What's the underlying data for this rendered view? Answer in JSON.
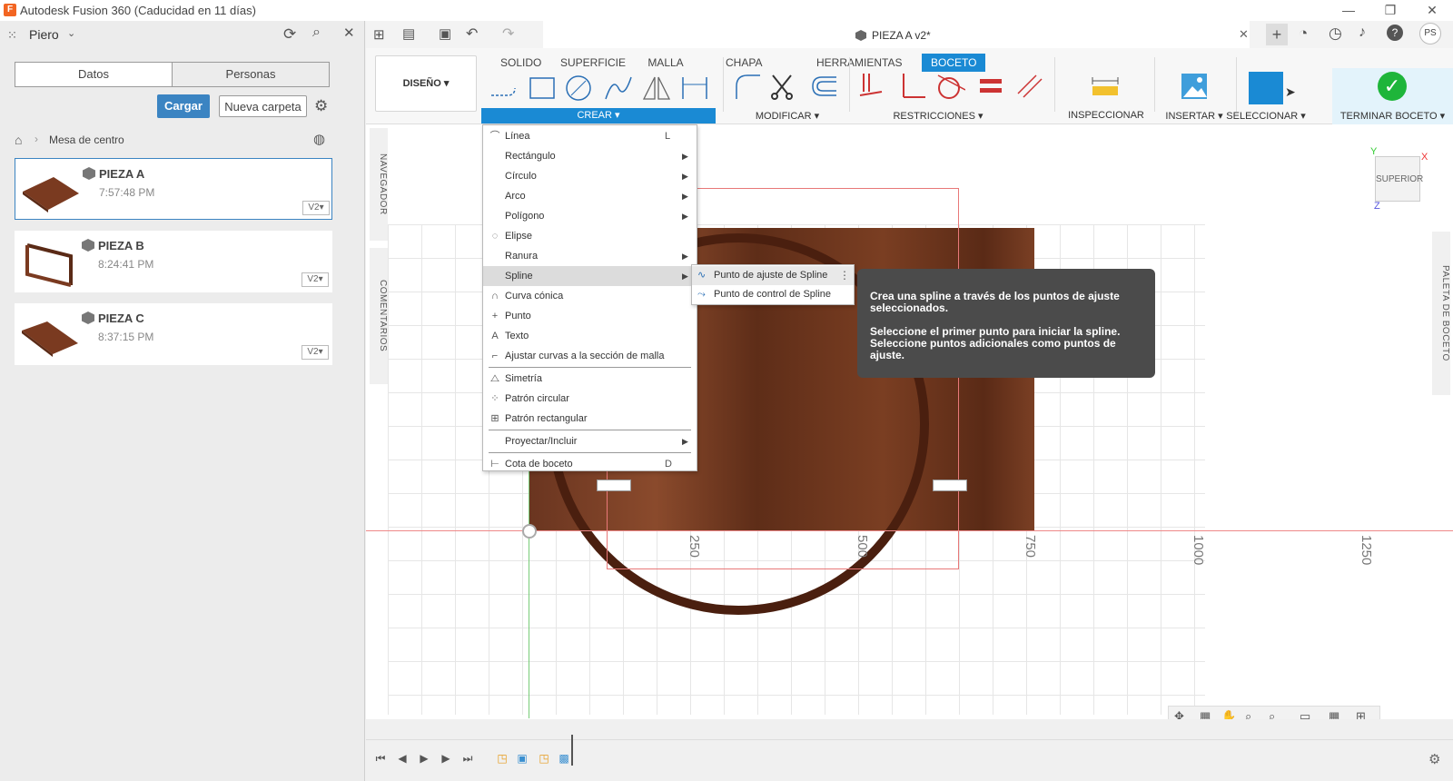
{
  "window": {
    "title": "Autodesk Fusion 360 (Caducidad en 11 días)",
    "logo": "F",
    "minimize": "—",
    "maximize": "❐",
    "close": "✕"
  },
  "leftpanel": {
    "user": "Piero",
    "tabs": [
      "Datos",
      "Personas"
    ],
    "upload_label": "Cargar",
    "new_folder_label": "Nueva carpeta",
    "breadcrumb": "Mesa de centro",
    "items": [
      {
        "name": "PIEZA A",
        "time": "7:57:48 PM",
        "version": "V2▾"
      },
      {
        "name": "PIEZA B",
        "time": "8:24:41 PM",
        "version": "V2▾"
      },
      {
        "name": "PIEZA C",
        "time": "8:37:15 PM",
        "version": "V2▾"
      }
    ]
  },
  "document": {
    "title": "PIEZA A v2*"
  },
  "ribbon": {
    "workspace": "DISEÑO ▾",
    "tabs": [
      "SOLIDO",
      "SUPERFICIE",
      "MALLA",
      "CHAPA",
      "HERRAMIENTAS",
      "BOCETO"
    ],
    "groups": {
      "crear": "CREAR ▾",
      "modificar": "MODIFICAR ▾",
      "restricciones": "RESTRICCIONES ▾",
      "inspeccionar": "INSPECCIONAR ▾",
      "insertar": "INSERTAR ▾",
      "seleccionar": "SELECCIONAR ▾",
      "terminar": "TERMINAR BOCETO ▾"
    }
  },
  "crear_menu": [
    {
      "label": "Línea",
      "shortcut": "L",
      "icon": "line-icon",
      "glyph": "⌒"
    },
    {
      "label": "Rectángulo",
      "submenu": true
    },
    {
      "label": "Círculo",
      "submenu": true
    },
    {
      "label": "Arco",
      "submenu": true
    },
    {
      "label": "Polígono",
      "submenu": true
    },
    {
      "label": "Elipse",
      "icon": "ellipse-icon",
      "glyph": "◌"
    },
    {
      "label": "Ranura",
      "submenu": true
    },
    {
      "label": "Spline",
      "submenu": true,
      "highlight": true
    },
    {
      "label": "Curva cónica",
      "icon": "conic-icon",
      "glyph": "∩"
    },
    {
      "label": "Punto",
      "icon": "point-icon",
      "glyph": "+"
    },
    {
      "label": "Texto",
      "icon": "text-icon",
      "glyph": "A"
    },
    {
      "label": "Ajustar curvas a la sección de malla",
      "icon": "fit-curves-icon",
      "glyph": "⌐",
      "sep_after": true
    },
    {
      "label": "Simetría",
      "icon": "mirror-icon",
      "glyph": "⧍"
    },
    {
      "label": "Patrón circular",
      "icon": "circular-pattern-icon",
      "glyph": "⁘"
    },
    {
      "label": "Patrón rectangular",
      "icon": "rectangular-pattern-icon",
      "glyph": "⊞",
      "sep_after": true
    },
    {
      "label": "Proyectar/Incluir",
      "submenu": true,
      "sep_after": true
    },
    {
      "label": "Cota de boceto",
      "shortcut": "D",
      "icon": "dimension-icon",
      "glyph": "⊢"
    }
  ],
  "spline_submenu": [
    {
      "label": "Punto de ajuste de Spline",
      "glyph": "∿"
    },
    {
      "label": "Punto de control de Spline",
      "glyph": "⤳"
    }
  ],
  "tooltip": {
    "line1": "Crea una spline a través de los puntos de ajuste seleccionados.",
    "line2": "Seleccione el primer punto para iniciar la spline. Seleccione puntos adicionales como puntos de ajuste."
  },
  "viewport": {
    "navigator": "NAVEGADOR",
    "comments": "COMENTARIOS",
    "palette": "PALETA DE BOCETO",
    "viewcube": "SUPERIOR",
    "axis_x": "X",
    "axis_y": "Y",
    "axis_z": "Z",
    "dims": [
      "250",
      "500",
      "750",
      "1000",
      "1250"
    ]
  },
  "colors": {
    "accent": "#1a8ad4",
    "green": "#1eb53a"
  }
}
